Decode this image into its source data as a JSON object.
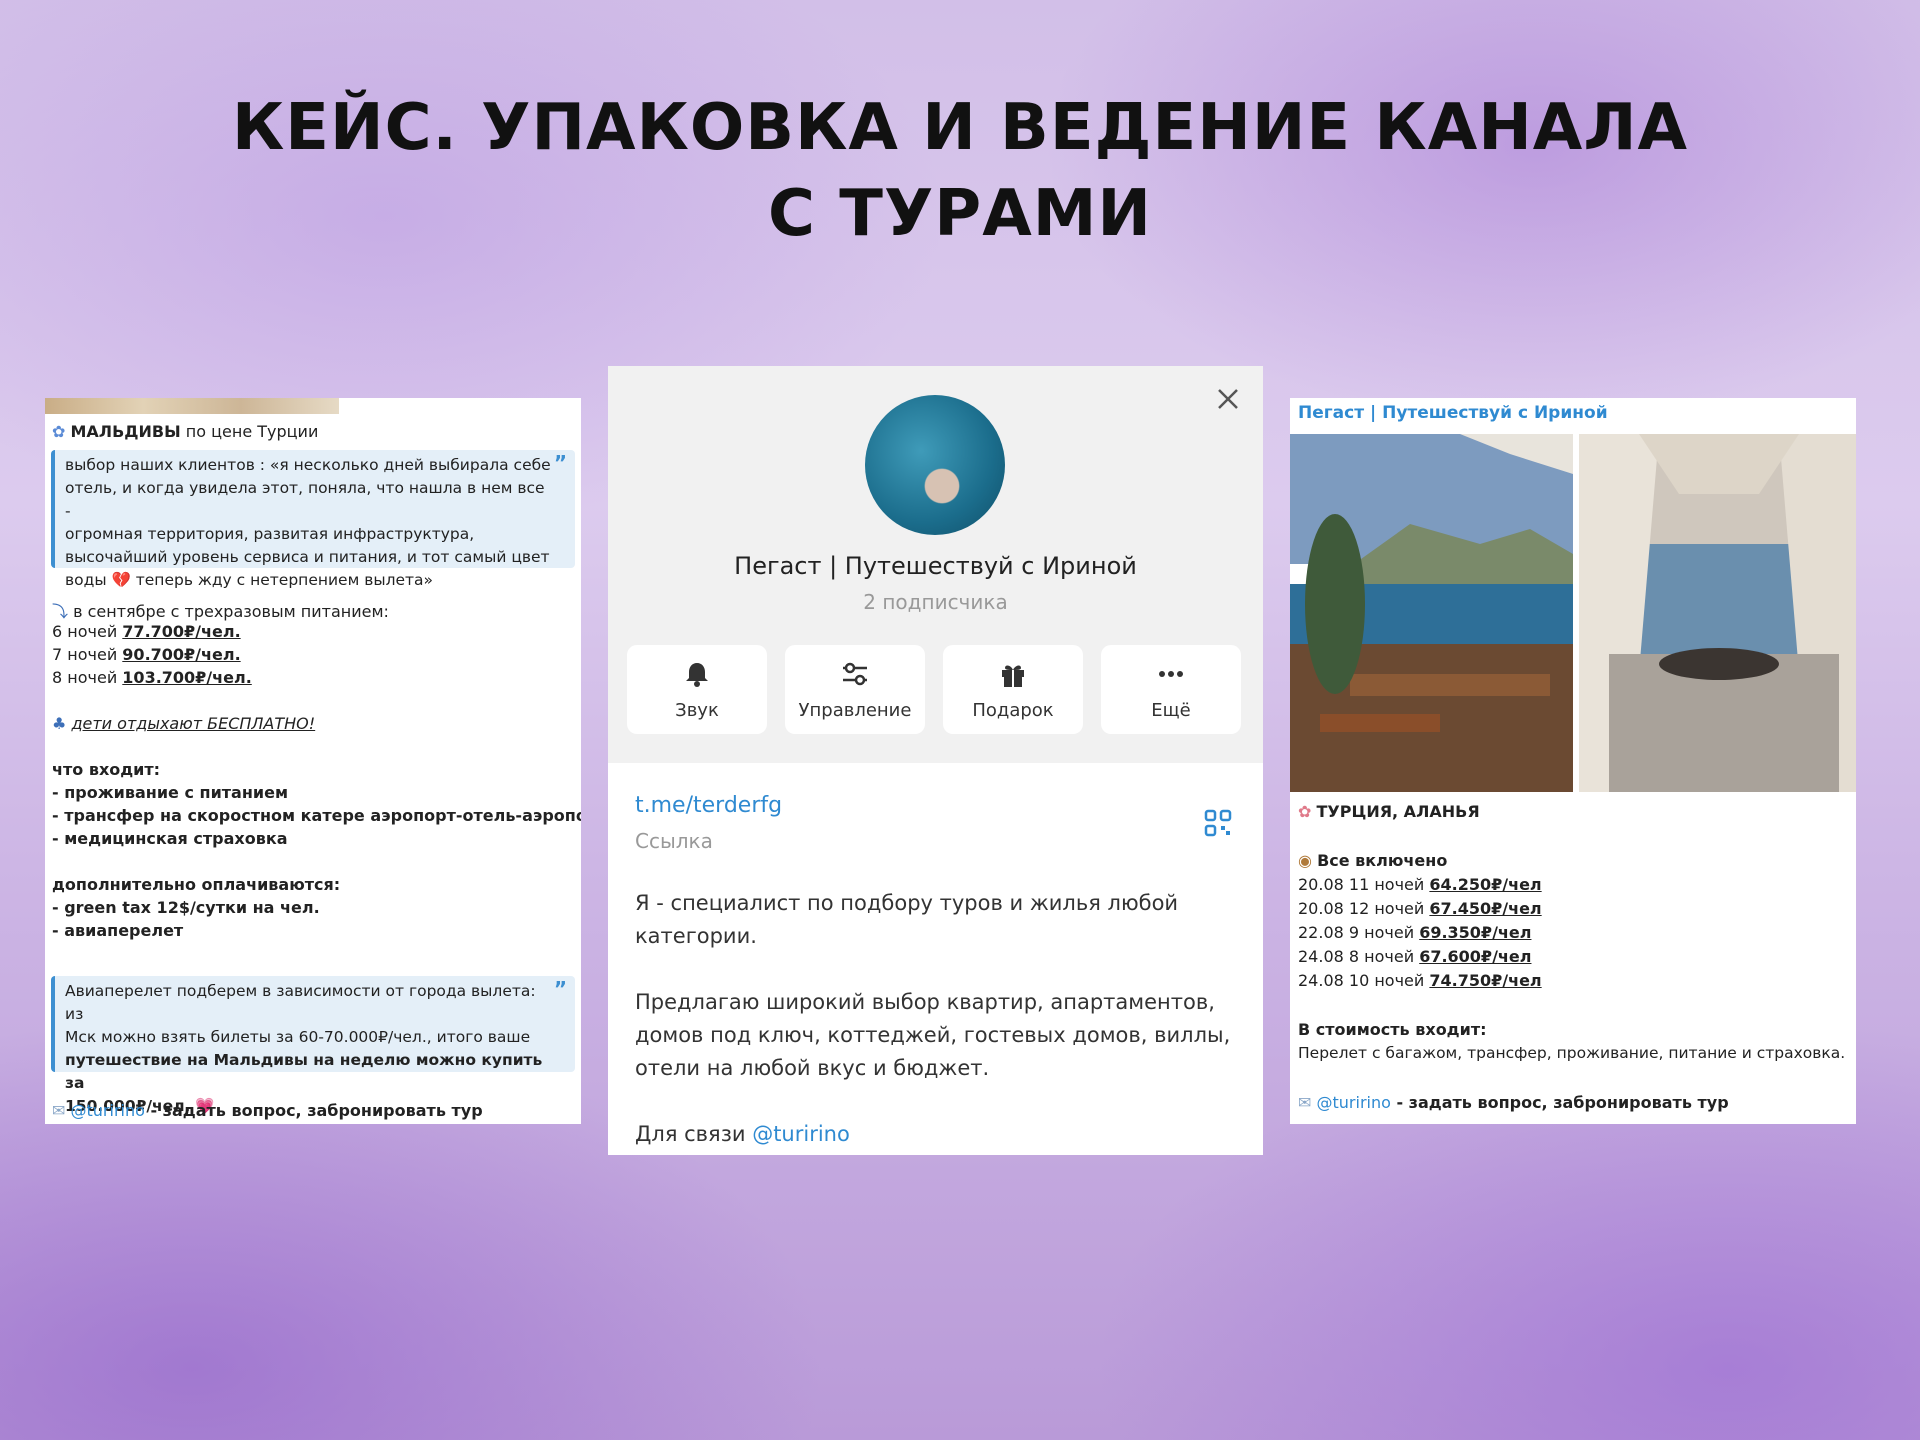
{
  "title": {
    "line1": "КЕЙС. УПАКОВКА И ВЕДЕНИЕ КАНАЛА",
    "line2": "С ТУРАМИ"
  },
  "left_post": {
    "heading_bold": "МАЛЬДИВЫ",
    "heading_rest": " по цене Турции",
    "quote1": {
      "line1": "выбор наших клиентов : «я несколько дней выбирала себе",
      "line2": "отель, и когда увидела этот, поняла, что нашла в нем все -",
      "line3": "огромная территория, развитая инфраструктура,",
      "line4": "высочайший уровень сервиса и питания, и тот самый цвет",
      "line5a": "воды ",
      "line5b": " теперь жду с нетерпением вылета»"
    },
    "september": "в сентябре с трехразовым питанием:",
    "prices": [
      {
        "nights": "6 ночей ",
        "price": "77.700₽/чел."
      },
      {
        "nights": "7 ночей ",
        "price": "90.700₽/чел."
      },
      {
        "nights": "8 ночей ",
        "price": "103.700₽/чел."
      }
    ],
    "kids": "дети отдыхают БЕСПЛАТНО!",
    "includes_title": "что входит:",
    "includes": [
      "- проживание с питанием",
      "- трансфер на скоростном катере аэропорт-отель-аэропорт",
      "- медицинская страховка"
    ],
    "extra_title": "дополнительно оплачиваются:",
    "extras": [
      "- green tax 12$/сутки на чел.",
      "- авиаперелет"
    ],
    "quote2": {
      "line1": "Авиаперелет подберем в зависимости от города вылета: из",
      "line2": "Мск можно взять билеты за 60-70.000₽/чел., итого ваше",
      "line3": "путешествие на Мальдивы на неделю можно купить за",
      "line4": "150.000₽/чел."
    },
    "contact_handle": "@turirino",
    "contact_text": " - задать  вопрос, забронировать тур"
  },
  "profile": {
    "name": "Пегаст | Путешествуй с Ириной",
    "subscribers": "2 подписчика",
    "buttons": [
      {
        "label": "Звук",
        "icon": "bell-icon"
      },
      {
        "label": "Управление",
        "icon": "sliders-icon"
      },
      {
        "label": "Подарок",
        "icon": "gift-icon"
      },
      {
        "label": "Ещё",
        "icon": "more-icon"
      }
    ],
    "link": "t.me/terderfg",
    "link_caption": "Ссылка",
    "bio1_line1": "Я - специалист по подбору туров и жилья любой",
    "bio1_line2": "категории.",
    "bio2_line1": "Предлагаю широкий выбор квартир, апартаментов,",
    "bio2_line2": "домов под ключ, коттеджей, гостевых домов, виллы,",
    "bio2_line3": "отели на любой вкус и бюджет.",
    "contact_prefix": "Для связи ",
    "contact_handle": "@turirino"
  },
  "right_post": {
    "channel": "Пегаст | Путешествуй с Ириной",
    "heading": "ТУРЦИЯ, АЛАНЬЯ",
    "all_inclusive": "Все включено",
    "tours": [
      {
        "date": "20.08 11 ночей ",
        "price": "64.250₽/чел"
      },
      {
        "date": "20.08 12 ночей ",
        "price": "67.450₽/чел"
      },
      {
        "date": "22.08 9 ночей ",
        "price": "69.350₽/чел"
      },
      {
        "date": "24.08 8 ночей ",
        "price": "67.600₽/чел"
      },
      {
        "date": "24.08 10 ночей ",
        "price": "74.750₽/чел"
      }
    ],
    "includes_title": "В стоимость входит:",
    "includes_text": "Перелет с багажом, трансфер, проживание, питание и страховка.",
    "contact_handle": "@turirino",
    "contact_text": " - задать  вопрос, забронировать тур"
  },
  "colors": {
    "accent": "#2f8ad1",
    "quote_bg": "#e4eff8"
  }
}
